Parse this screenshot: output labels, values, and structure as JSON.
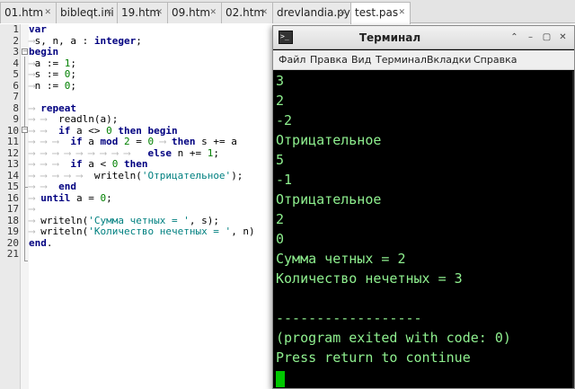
{
  "tabs": [
    {
      "label": "01.htm"
    },
    {
      "label": "bibleqt.ini"
    },
    {
      "label": "19.htm"
    },
    {
      "label": "09.htm"
    },
    {
      "label": "02.htm"
    },
    {
      "label": "drevlandia.py"
    },
    {
      "label": "test.pas"
    }
  ],
  "tab_close_glyph": "✕",
  "editor": {
    "line_numbers": [
      "1",
      "2",
      "3",
      "4",
      "5",
      "6",
      "7",
      "8",
      "9",
      "10",
      "11",
      "12",
      "13",
      "14",
      "15",
      "16",
      "17",
      "18",
      "19",
      "20",
      "21"
    ],
    "tokens": {
      "l1_kw": "var",
      "l2_text": "s, n, a : ",
      "l2_type": "integer",
      "l2_end": ";",
      "l3_kw": "begin",
      "l4_text": "a := ",
      "l4_num": "1",
      "l4_end": ";",
      "l5_text": "s := ",
      "l5_num": "0",
      "l5_end": ";",
      "l6_text": "n := ",
      "l6_num": "0",
      "l6_end": ";",
      "l8_kw": "repeat",
      "l9_text": "readln(a);",
      "l10_if": "if",
      "l10_text": " a <> ",
      "l10_num": "0",
      "l10_then": " then begin",
      "l11_if": "if",
      "l11_text": " a ",
      "l11_mod": "mod",
      "l11_text2": " ",
      "l11_num": "2",
      "l11_text3": " = ",
      "l11_num2": "0",
      "l11_then": " then",
      "l11_text4": " s += a",
      "l12_else": "else",
      "l12_text": " n += ",
      "l12_num": "1",
      "l12_end": ";",
      "l13_if": "if",
      "l13_text": " a < ",
      "l13_num": "0",
      "l13_then": " then",
      "l14_text": "writeln(",
      "l14_str": "'Отрицательное'",
      "l14_end": ");",
      "l15_kw": "end",
      "l16_until": "until",
      "l16_text": " a = ",
      "l16_num": "0",
      "l16_end": ";",
      "l18_text": "writeln(",
      "l18_str": "'Сумма четных = '",
      "l18_end": ", s);",
      "l19_text": "writeln(",
      "l19_str": "'Количество нечетных = '",
      "l19_end": ", n)",
      "l20_kw": "end",
      "l20_end": "."
    }
  },
  "terminal": {
    "title": "Терминал",
    "icon_glyph": ">_",
    "controls": {
      "up": "⌃",
      "minimize": "–",
      "maximize": "▢",
      "close": "✕"
    },
    "menu": [
      "Файл",
      "Правка",
      "Вид",
      "Терминал",
      "Вкладки",
      "Справка"
    ],
    "output": [
      "3",
      "2",
      "-2",
      "Отрицательное",
      "5",
      "-1",
      "Отрицательное",
      "2",
      "0",
      "Сумма четных = 2",
      "Количество нечетных = 3",
      "",
      "",
      "------------------",
      "(program exited with code: 0)",
      "Press return to continue"
    ],
    "text_color": "#8ff08f",
    "cursor_color": "#00c800"
  }
}
